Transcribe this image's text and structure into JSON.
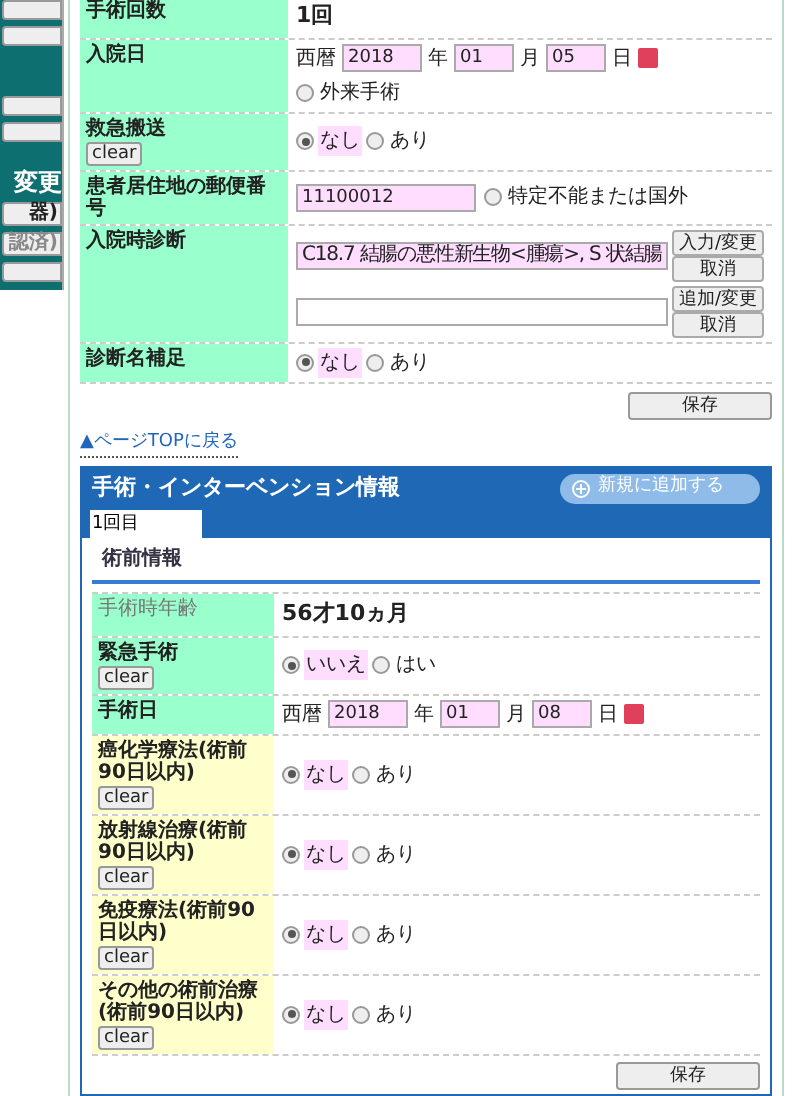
{
  "sidebar": {
    "items": [
      {
        "kind": "button"
      },
      {
        "kind": "button"
      },
      {
        "kind": "gap"
      },
      {
        "kind": "button"
      },
      {
        "kind": "button"
      },
      {
        "kind": "heading",
        "label": "変更"
      },
      {
        "kind": "button",
        "label": "器)",
        "disabled": false
      },
      {
        "kind": "button",
        "label": "認済)",
        "disabled": true
      },
      {
        "kind": "button"
      }
    ]
  },
  "admission_form": {
    "rows": [
      {
        "label": "手術回数",
        "kind": "text",
        "value": "1回"
      },
      {
        "label": "入院日",
        "kind": "date",
        "era": "西暦",
        "year": "2018",
        "year_unit": "年",
        "month": "01",
        "month_unit": "月",
        "day": "05",
        "day_unit": "日",
        "options": [
          {
            "label": "外来手術",
            "selected": false
          }
        ]
      },
      {
        "label": "救急搬送",
        "clear_button": "clear",
        "kind": "radio",
        "options": [
          {
            "label": "なし",
            "selected": true
          },
          {
            "label": "あり",
            "selected": false
          }
        ]
      },
      {
        "label": "患者居住地の郵便番号",
        "kind": "postal",
        "value": "11100012",
        "options": [
          {
            "label": "特定不能または国外",
            "selected": false
          }
        ]
      },
      {
        "label": "入院時診断",
        "kind": "diagnosis",
        "inputs": [
          {
            "value": "C18.7 結腸の悪性新生物<腫瘍>, S 状結腸",
            "buttons": [
              "入力/変更",
              "取消"
            ]
          },
          {
            "buttons": [
              "追加/変更",
              "取消"
            ]
          }
        ]
      },
      {
        "label": "診断名補足",
        "kind": "radio",
        "options": [
          {
            "label": "なし",
            "selected": true
          },
          {
            "label": "あり",
            "selected": false
          }
        ]
      }
    ],
    "save_button": "保存"
  },
  "page_top_link": "▲ページTOPに戻る",
  "surgery_panel": {
    "title": "手術・インターベンション情報",
    "add_button": "新規に追加する",
    "tabs": [
      {
        "label": "1回目",
        "selected": true
      }
    ],
    "section_title": "術前情報",
    "rows": [
      {
        "label": "手術時年齢",
        "color": "#99ffcc",
        "readonly": true,
        "kind": "text",
        "value": "56才10ヵ月"
      },
      {
        "label": "緊急手術",
        "color": "#99ffcc",
        "readonly": false,
        "clear_button": "clear",
        "kind": "radio",
        "options": [
          {
            "label": "いいえ",
            "selected": true
          },
          {
            "label": "はい",
            "selected": false
          }
        ]
      },
      {
        "label": "手術日",
        "color": "#99ffcc",
        "readonly": false,
        "kind": "date",
        "era": "西暦",
        "year": "2018",
        "year_unit": "年",
        "month": "01",
        "month_unit": "月",
        "day": "08",
        "day_unit": "日"
      },
      {
        "label": "癌化学療法(術前90日以内)",
        "color": "#ffffcc",
        "readonly": false,
        "clear_button": "clear",
        "kind": "radio",
        "options": [
          {
            "label": "なし",
            "selected": true
          },
          {
            "label": "あり",
            "selected": false
          }
        ]
      },
      {
        "label": "放射線治療(術前90日以内)",
        "color": "#ffffcc",
        "readonly": false,
        "clear_button": "clear",
        "kind": "radio",
        "options": [
          {
            "label": "なし",
            "selected": true
          },
          {
            "label": "あり",
            "selected": false
          }
        ]
      },
      {
        "label": "免疫療法(術前90日以内)",
        "color": "#ffffcc",
        "readonly": false,
        "clear_button": "clear",
        "kind": "radio",
        "options": [
          {
            "label": "なし",
            "selected": true
          },
          {
            "label": "あり",
            "selected": false
          }
        ]
      },
      {
        "label": "その他の術前治療(術前90日以内)",
        "color": "#ffffcc",
        "readonly": false,
        "clear_button": "clear",
        "kind": "radio",
        "options": [
          {
            "label": "なし",
            "selected": true
          },
          {
            "label": "あり",
            "selected": false
          }
        ]
      }
    ],
    "save_button": "保存"
  }
}
